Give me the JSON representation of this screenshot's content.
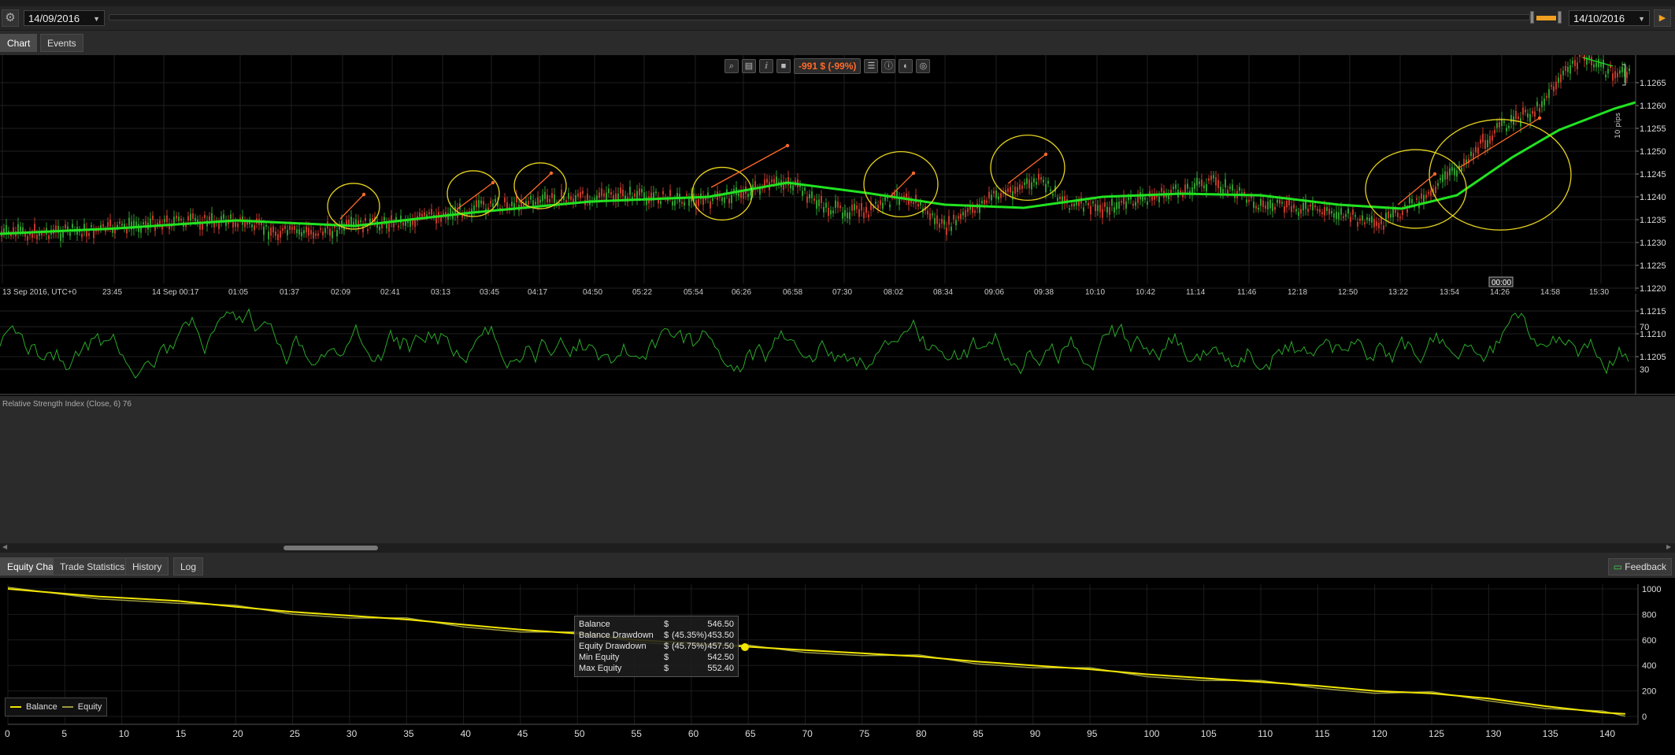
{
  "toolbar": {
    "start_date": "14/09/2016",
    "end_date": "14/10/2016"
  },
  "tabs": [
    "Chart",
    "Events"
  ],
  "chart": {
    "pnl": "-991 $ (-99%)",
    "pips_label": "10 pips",
    "price_axis": [
      "1.1265",
      "1.1260",
      "1.1255",
      "1.1250",
      "1.1245",
      "1.1240",
      "1.1235",
      "1.1230",
      "1.1225",
      "1.1220",
      "1.1215",
      "1.1210",
      "1.1205"
    ],
    "time_axis": [
      "13 Sep 2016, UTC+0",
      "23:45",
      "14 Sep 00:17",
      "01:05",
      "01:37",
      "02:09",
      "02:41",
      "03:13",
      "03:45",
      "04:17",
      "04:50",
      "05:22",
      "05:54",
      "06:26",
      "06:58",
      "07:30",
      "08:02",
      "08:34",
      "09:06",
      "09:38",
      "10:10",
      "10:42",
      "11:14",
      "11:46",
      "12:18",
      "12:50",
      "13:22",
      "13:54",
      "14:26",
      "14:58",
      "15:30"
    ],
    "cursor_time": "00:00",
    "rsi_title": "Relative Strength Index (Close, 6) 76",
    "rsi_axis": [
      "70",
      "30"
    ],
    "colors": {
      "candle_up": "#2e9b2e",
      "candle_down": "#c0392b",
      "ma": "#21e321",
      "circle": "#e6d31e",
      "trend": "#ff6a2a",
      "rsi": "#29a829"
    }
  },
  "bottom_tabs": [
    "Equity Chart",
    "Trade Statistics",
    "History",
    "Log"
  ],
  "feedback_label": "Feedback",
  "equity": {
    "y_axis": [
      "1000",
      "800",
      "600",
      "400",
      "200",
      "0"
    ],
    "x_axis": [
      "0",
      "5",
      "10",
      "15",
      "20",
      "25",
      "30",
      "35",
      "40",
      "45",
      "50",
      "55",
      "60",
      "65",
      "70",
      "75",
      "80",
      "85",
      "90",
      "95",
      "100",
      "105",
      "110",
      "115",
      "120",
      "125",
      "130",
      "135",
      "140"
    ],
    "tooltip": [
      {
        "label": "Balance",
        "cur": "$",
        "pct": "",
        "val": "546.50"
      },
      {
        "label": "Balance Drawdown",
        "cur": "$",
        "pct": "(45.35%)",
        "val": "453.50"
      },
      {
        "label": "Equity Drawdown",
        "cur": "$",
        "pct": "(45.75%)",
        "val": "457.50"
      },
      {
        "label": "Min Equity",
        "cur": "$",
        "pct": "",
        "val": "542.50"
      },
      {
        "label": "Max Equity",
        "cur": "$",
        "pct": "",
        "val": "552.40"
      }
    ],
    "legend": {
      "balance": "Balance",
      "equity": "Equity"
    },
    "colors": {
      "balance": "#f2e600",
      "equity": "#9a9a40"
    }
  }
}
